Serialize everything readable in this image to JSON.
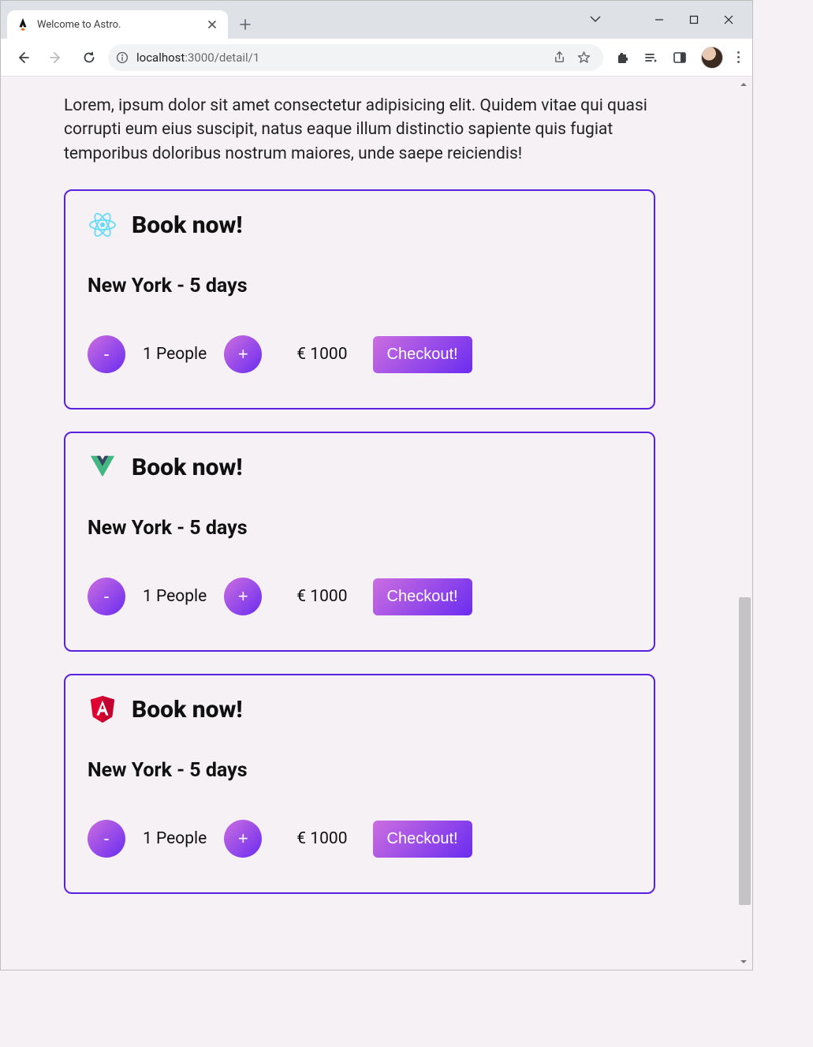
{
  "browser": {
    "tab_title": "Welcome to Astro.",
    "url_host": "localhost",
    "url_port": ":3000",
    "url_path": "/detail/1"
  },
  "page": {
    "intro": "Lorem, ipsum dolor sit amet consectetur adipisicing elit. Quidem vitae qui quasi corrupti eum eius suscipit, natus eaque illum distinctio sapiente quis fugiat temporibus doloribus nostrum maiores, unde saepe reiciendis!"
  },
  "cards": [
    {
      "framework": "react",
      "title": "Book now!",
      "subtitle": "New York - 5 days",
      "minus": "-",
      "plus": "+",
      "people": "1 People",
      "price": "€ 1000",
      "checkout": "Checkout!"
    },
    {
      "framework": "vue",
      "title": "Book now!",
      "subtitle": "New York - 5 days",
      "minus": "-",
      "plus": "+",
      "people": "1 People",
      "price": "€ 1000",
      "checkout": "Checkout!"
    },
    {
      "framework": "angular",
      "title": "Book now!",
      "subtitle": "New York - 5 days",
      "minus": "-",
      "plus": "+",
      "people": "1 People",
      "price": "€ 1000",
      "checkout": "Checkout!"
    }
  ]
}
